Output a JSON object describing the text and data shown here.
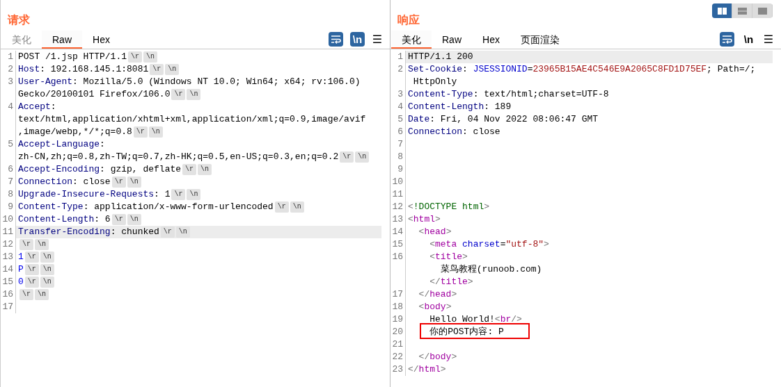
{
  "layout_toggle": [
    {
      "selected": true
    },
    {
      "selected": false
    },
    {
      "selected": false
    }
  ],
  "panels": [
    {
      "title": "请求",
      "tabs": [
        {
          "label": "美化",
          "selected": false,
          "disabled": true
        },
        {
          "label": "Raw",
          "selected": true,
          "disabled": false
        },
        {
          "label": "Hex",
          "selected": false,
          "disabled": false
        }
      ],
      "toolbar": {
        "wrap": {
          "on": true
        },
        "newline": {
          "label": "\\n",
          "on": true
        },
        "menu": {
          "label": "☰"
        }
      },
      "lines": [
        {
          "number": "1",
          "highlighted": false,
          "boxed": false,
          "rows": [
            {
              "segments": [
                {
                  "kind": "text",
                  "text": "POST /1.jsp HTTP/1.1"
                },
                {
                  "kind": "chip",
                  "text": "\\r"
                },
                {
                  "kind": "chip",
                  "text": "\\n"
                }
              ]
            }
          ]
        },
        {
          "number": "2",
          "highlighted": false,
          "boxed": false,
          "rows": [
            {
              "segments": [
                {
                  "kind": "key",
                  "text": "Host"
                },
                {
                  "kind": "text",
                  "text": ": 192.168.145.1:8081"
                },
                {
                  "kind": "chip",
                  "text": "\\r"
                },
                {
                  "kind": "chip",
                  "text": "\\n"
                }
              ]
            }
          ]
        },
        {
          "number": "3",
          "highlighted": false,
          "boxed": false,
          "rows": [
            {
              "segments": [
                {
                  "kind": "key",
                  "text": "User-Agent"
                },
                {
                  "kind": "text",
                  "text": ": Mozilla/5.0 (Windows NT 10.0; Win64; x64; rv:106.0)"
                }
              ]
            },
            {
              "segments": [
                {
                  "kind": "text",
                  "text": "Gecko/20100101 Firefox/106.0"
                },
                {
                  "kind": "chip",
                  "text": "\\r"
                },
                {
                  "kind": "chip",
                  "text": "\\n"
                }
              ]
            }
          ]
        },
        {
          "number": "4",
          "highlighted": false,
          "boxed": false,
          "rows": [
            {
              "segments": [
                {
                  "kind": "key",
                  "text": "Accept"
                },
                {
                  "kind": "text",
                  "text": ":"
                }
              ]
            },
            {
              "segments": [
                {
                  "kind": "text",
                  "text": "text/html,application/xhtml+xml,application/xml;q=0.9,image/avif"
                }
              ]
            },
            {
              "segments": [
                {
                  "kind": "text",
                  "text": ",image/webp,*/*;q=0.8"
                },
                {
                  "kind": "chip",
                  "text": "\\r"
                },
                {
                  "kind": "chip",
                  "text": "\\n"
                }
              ]
            }
          ]
        },
        {
          "number": "5",
          "highlighted": false,
          "boxed": false,
          "rows": [
            {
              "segments": [
                {
                  "kind": "key",
                  "text": "Accept-Language"
                },
                {
                  "kind": "text",
                  "text": ":"
                }
              ]
            },
            {
              "segments": [
                {
                  "kind": "text",
                  "text": "zh-CN,zh;q=0.8,zh-TW;q=0.7,zh-HK;q=0.5,en-US;q=0.3,en;q=0.2"
                },
                {
                  "kind": "chip",
                  "text": "\\r"
                },
                {
                  "kind": "chip",
                  "text": "\\n"
                }
              ]
            }
          ]
        },
        {
          "number": "6",
          "highlighted": false,
          "boxed": false,
          "rows": [
            {
              "segments": [
                {
                  "kind": "key",
                  "text": "Accept-Encoding"
                },
                {
                  "kind": "text",
                  "text": ": gzip, deflate"
                },
                {
                  "kind": "chip",
                  "text": "\\r"
                },
                {
                  "kind": "chip",
                  "text": "\\n"
                }
              ]
            }
          ]
        },
        {
          "number": "7",
          "highlighted": false,
          "boxed": false,
          "rows": [
            {
              "segments": [
                {
                  "kind": "key",
                  "text": "Connection"
                },
                {
                  "kind": "text",
                  "text": ": close"
                },
                {
                  "kind": "chip",
                  "text": "\\r"
                },
                {
                  "kind": "chip",
                  "text": "\\n"
                }
              ]
            }
          ]
        },
        {
          "number": "8",
          "highlighted": false,
          "boxed": false,
          "rows": [
            {
              "segments": [
                {
                  "kind": "key",
                  "text": "Upgrade-Insecure-Requests"
                },
                {
                  "kind": "text",
                  "text": ": 1"
                },
                {
                  "kind": "chip",
                  "text": "\\r"
                },
                {
                  "kind": "chip",
                  "text": "\\n"
                }
              ]
            }
          ]
        },
        {
          "number": "9",
          "highlighted": false,
          "boxed": false,
          "rows": [
            {
              "segments": [
                {
                  "kind": "key",
                  "text": "Content-Type"
                },
                {
                  "kind": "text",
                  "text": ": application/x-www-form-urlencoded"
                },
                {
                  "kind": "chip",
                  "text": "\\r"
                },
                {
                  "kind": "chip",
                  "text": "\\n"
                }
              ]
            }
          ]
        },
        {
          "number": "10",
          "highlighted": false,
          "boxed": false,
          "rows": [
            {
              "segments": [
                {
                  "kind": "key",
                  "text": "Content-Length"
                },
                {
                  "kind": "text",
                  "text": ": 6"
                },
                {
                  "kind": "chip",
                  "text": "\\r"
                },
                {
                  "kind": "chip",
                  "text": "\\n"
                }
              ]
            }
          ]
        },
        {
          "number": "11",
          "highlighted": true,
          "boxed": false,
          "rows": [
            {
              "segments": [
                {
                  "kind": "key",
                  "text": "Transfer-Encoding"
                },
                {
                  "kind": "text",
                  "text": ": chunked"
                },
                {
                  "kind": "chip",
                  "text": "\\r"
                },
                {
                  "kind": "chip",
                  "text": "\\n"
                }
              ]
            }
          ]
        },
        {
          "number": "12",
          "highlighted": false,
          "boxed": false,
          "rows": [
            {
              "segments": [
                {
                  "kind": "chip",
                  "text": "\\r"
                },
                {
                  "kind": "chip",
                  "text": "\\n"
                }
              ]
            }
          ]
        },
        {
          "number": "13",
          "highlighted": false,
          "boxed": false,
          "rows": [
            {
              "segments": [
                {
                  "kind": "body",
                  "text": "1"
                },
                {
                  "kind": "chip",
                  "text": "\\r"
                },
                {
                  "kind": "chip",
                  "text": "\\n"
                }
              ]
            }
          ]
        },
        {
          "number": "14",
          "highlighted": false,
          "boxed": false,
          "rows": [
            {
              "segments": [
                {
                  "kind": "body",
                  "text": "P"
                },
                {
                  "kind": "chip",
                  "text": "\\r"
                },
                {
                  "kind": "chip",
                  "text": "\\n"
                }
              ]
            }
          ]
        },
        {
          "number": "15",
          "highlighted": false,
          "boxed": false,
          "rows": [
            {
              "segments": [
                {
                  "kind": "body",
                  "text": "0"
                },
                {
                  "kind": "chip",
                  "text": "\\r"
                },
                {
                  "kind": "chip",
                  "text": "\\n"
                }
              ]
            }
          ]
        },
        {
          "number": "16",
          "highlighted": false,
          "boxed": false,
          "rows": [
            {
              "segments": [
                {
                  "kind": "chip",
                  "text": "\\r"
                },
                {
                  "kind": "chip",
                  "text": "\\n"
                }
              ]
            }
          ]
        },
        {
          "number": "17",
          "highlighted": false,
          "boxed": false,
          "rows": [
            {
              "segments": []
            }
          ]
        }
      ]
    },
    {
      "title": "响应",
      "tabs": [
        {
          "label": "美化",
          "selected": true,
          "disabled": false
        },
        {
          "label": "Raw",
          "selected": false,
          "disabled": false
        },
        {
          "label": "Hex",
          "selected": false,
          "disabled": false
        },
        {
          "label": "页面渲染",
          "selected": false,
          "disabled": false
        }
      ],
      "toolbar": {
        "wrap": {
          "on": true
        },
        "newline": {
          "label": "\\n",
          "on": false
        },
        "menu": {
          "label": "☰"
        }
      },
      "lines": [
        {
          "number": "1",
          "highlighted": true,
          "boxed": false,
          "rows": [
            {
              "segments": [
                {
                  "kind": "text",
                  "text": "HTTP/1.1 200"
                }
              ]
            }
          ]
        },
        {
          "number": "2",
          "highlighted": false,
          "boxed": false,
          "rows": [
            {
              "segments": [
                {
                  "kind": "key",
                  "text": "Set-Cookie"
                },
                {
                  "kind": "text",
                  "text": ": "
                },
                {
                  "kind": "attr",
                  "text": "JSESSIONID"
                },
                {
                  "kind": "text",
                  "text": "="
                },
                {
                  "kind": "string",
                  "text": "23965B15AE4C546E9A2065C8FD1D75EF"
                },
                {
                  "kind": "text",
                  "text": "; Path=/;"
                }
              ]
            },
            {
              "segments": [
                {
                  "kind": "text",
                  "text": " HttpOnly"
                }
              ]
            }
          ]
        },
        {
          "number": "3",
          "highlighted": false,
          "boxed": false,
          "rows": [
            {
              "segments": [
                {
                  "kind": "key",
                  "text": "Content-Type"
                },
                {
                  "kind": "text",
                  "text": ": text/html;charset=UTF-8"
                }
              ]
            }
          ]
        },
        {
          "number": "4",
          "highlighted": false,
          "boxed": false,
          "rows": [
            {
              "segments": [
                {
                  "kind": "key",
                  "text": "Content-Length"
                },
                {
                  "kind": "text",
                  "text": ": 189"
                }
              ]
            }
          ]
        },
        {
          "number": "5",
          "highlighted": false,
          "boxed": false,
          "rows": [
            {
              "segments": [
                {
                  "kind": "key",
                  "text": "Date"
                },
                {
                  "kind": "text",
                  "text": ": Fri, 04 Nov 2022 08:06:47 GMT"
                }
              ]
            }
          ]
        },
        {
          "number": "6",
          "highlighted": false,
          "boxed": false,
          "rows": [
            {
              "segments": [
                {
                  "kind": "key",
                  "text": "Connection"
                },
                {
                  "kind": "text",
                  "text": ": close"
                }
              ]
            }
          ]
        },
        {
          "number": "7",
          "highlighted": false,
          "boxed": false,
          "rows": [
            {
              "segments": []
            }
          ]
        },
        {
          "number": "8",
          "highlighted": false,
          "boxed": false,
          "rows": [
            {
              "segments": []
            }
          ]
        },
        {
          "number": "9",
          "highlighted": false,
          "boxed": false,
          "rows": [
            {
              "segments": []
            }
          ]
        },
        {
          "number": "10",
          "highlighted": false,
          "boxed": false,
          "rows": [
            {
              "segments": []
            }
          ]
        },
        {
          "number": "11",
          "highlighted": false,
          "boxed": false,
          "rows": [
            {
              "segments": []
            }
          ]
        },
        {
          "number": "12",
          "highlighted": false,
          "boxed": false,
          "rows": [
            {
              "segments": [
                {
                  "kind": "punct",
                  "text": "<"
                },
                {
                  "kind": "doctype",
                  "text": "!DOCTYPE html"
                },
                {
                  "kind": "punct",
                  "text": ">"
                }
              ]
            }
          ]
        },
        {
          "number": "13",
          "highlighted": false,
          "boxed": false,
          "rows": [
            {
              "segments": [
                {
                  "kind": "punct",
                  "text": "<"
                },
                {
                  "kind": "tag",
                  "text": "html"
                },
                {
                  "kind": "punct",
                  "text": ">"
                }
              ]
            }
          ]
        },
        {
          "number": "14",
          "highlighted": false,
          "boxed": false,
          "rows": [
            {
              "segments": [
                {
                  "kind": "punct",
                  "text": "  <"
                },
                {
                  "kind": "tag",
                  "text": "head"
                },
                {
                  "kind": "punct",
                  "text": ">"
                }
              ]
            }
          ]
        },
        {
          "number": "15",
          "highlighted": false,
          "boxed": false,
          "rows": [
            {
              "segments": [
                {
                  "kind": "punct",
                  "text": "    <"
                },
                {
                  "kind": "tag",
                  "text": "meta"
                },
                {
                  "kind": "attr",
                  "text": " charset"
                },
                {
                  "kind": "text",
                  "text": "="
                },
                {
                  "kind": "string",
                  "text": "\"utf-8\""
                },
                {
                  "kind": "punct",
                  "text": ">"
                }
              ]
            }
          ]
        },
        {
          "number": "16",
          "highlighted": false,
          "boxed": false,
          "rows": [
            {
              "segments": [
                {
                  "kind": "punct",
                  "text": "    <"
                },
                {
                  "kind": "tag",
                  "text": "title"
                },
                {
                  "kind": "punct",
                  "text": ">"
                }
              ]
            },
            {
              "segments": [
                {
                  "kind": "text",
                  "text": "      菜鸟教程(runoob.com)"
                }
              ]
            },
            {
              "segments": [
                {
                  "kind": "punct",
                  "text": "    </"
                },
                {
                  "kind": "tag",
                  "text": "title"
                },
                {
                  "kind": "punct",
                  "text": ">"
                }
              ]
            }
          ]
        },
        {
          "number": "17",
          "highlighted": false,
          "boxed": false,
          "rows": [
            {
              "segments": [
                {
                  "kind": "punct",
                  "text": "  </"
                },
                {
                  "kind": "tag",
                  "text": "head"
                },
                {
                  "kind": "punct",
                  "text": ">"
                }
              ]
            }
          ]
        },
        {
          "number": "18",
          "highlighted": false,
          "boxed": false,
          "rows": [
            {
              "segments": [
                {
                  "kind": "punct",
                  "text": "  <"
                },
                {
                  "kind": "tag",
                  "text": "body"
                },
                {
                  "kind": "punct",
                  "text": ">"
                }
              ]
            }
          ]
        },
        {
          "number": "19",
          "highlighted": false,
          "boxed": false,
          "rows": [
            {
              "segments": [
                {
                  "kind": "text",
                  "text": "    Hello World!"
                },
                {
                  "kind": "punct",
                  "text": "<"
                },
                {
                  "kind": "tag",
                  "text": "br"
                },
                {
                  "kind": "punct",
                  "text": "/>"
                }
              ]
            }
          ]
        },
        {
          "number": "20",
          "highlighted": false,
          "boxed": true,
          "rows": [
            {
              "segments": [
                {
                  "kind": "text",
                  "text": "    你的POST内容: P"
                }
              ]
            }
          ]
        },
        {
          "number": "21",
          "highlighted": false,
          "boxed": false,
          "rows": [
            {
              "segments": []
            }
          ]
        },
        {
          "number": "22",
          "highlighted": false,
          "boxed": false,
          "rows": [
            {
              "segments": [
                {
                  "kind": "punct",
                  "text": "  </"
                },
                {
                  "kind": "tag",
                  "text": "body"
                },
                {
                  "kind": "punct",
                  "text": ">"
                }
              ]
            }
          ]
        },
        {
          "number": "23",
          "highlighted": false,
          "boxed": false,
          "rows": [
            {
              "segments": [
                {
                  "kind": "punct",
                  "text": "</"
                },
                {
                  "kind": "tag",
                  "text": "html"
                },
                {
                  "kind": "punct",
                  "text": ">"
                }
              ]
            }
          ]
        }
      ]
    }
  ]
}
